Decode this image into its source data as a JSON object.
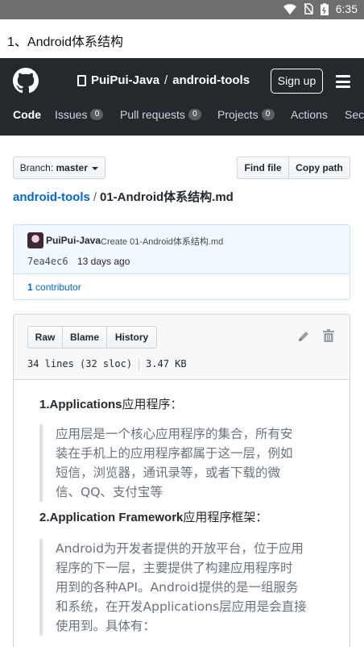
{
  "status_bar": {
    "time": "6:35",
    "icons": [
      "wifi-icon",
      "no-sim-icon",
      "battery-icon"
    ]
  },
  "app": {
    "title": "1、Android体系结构"
  },
  "header": {
    "owner": "PuiPui-Java",
    "separator": "/",
    "repo": "android-tools",
    "signup_label": "Sign up",
    "tabs": [
      {
        "label": "Code",
        "count": null
      },
      {
        "label": "Issues",
        "count": "0"
      },
      {
        "label": "Pull requests",
        "count": "0"
      },
      {
        "label": "Projects",
        "count": "0"
      },
      {
        "label": "Actions",
        "count": null
      },
      {
        "label": "Sec",
        "count": null
      }
    ]
  },
  "toolbar": {
    "branch_prefix": "Branch:",
    "branch_name": "master",
    "find_file_label": "Find file",
    "copy_path_label": "Copy path"
  },
  "breadcrumb": {
    "repo": "android-tools",
    "sep": "/",
    "file": "01-Android体系结构.md"
  },
  "commit": {
    "author": "PuiPui-Java",
    "message": "Create 01-Android体系结构.md",
    "sha": "7ea4ec6",
    "date": "13 days ago",
    "contributors_count": "1",
    "contributors_label": "contributor"
  },
  "file": {
    "raw_label": "Raw",
    "blame_label": "Blame",
    "history_label": "History",
    "lines": "34 lines (32 sloc)",
    "size": "3.47 KB"
  },
  "markdown": {
    "h1_en": "1.Applications",
    "h1_zh": "应用程序：",
    "q1": [
      "应用层是一个核心应用程序的集合，所有安",
      "装在手机上的应用程序都属于这一层，例如",
      "短信，浏览器，通讯录等，或者下载的微",
      "信、QQ、支付宝等"
    ],
    "h2_en": "2.Application Framework",
    "h2_zh": "应用程序框架：",
    "q2": [
      "Android为开发者提供的开放平台，位于应用",
      "程序的下一层，主要提供了构建应用程序时",
      "用到的各种API。Android提供的是一组服务",
      "和系统，在开发Applications层应用是会直接",
      "使用到。具体有："
    ]
  },
  "colors": {
    "header_bg": "#24292e",
    "link": "#0366d6",
    "commit_bg": "#f1f8ff"
  }
}
